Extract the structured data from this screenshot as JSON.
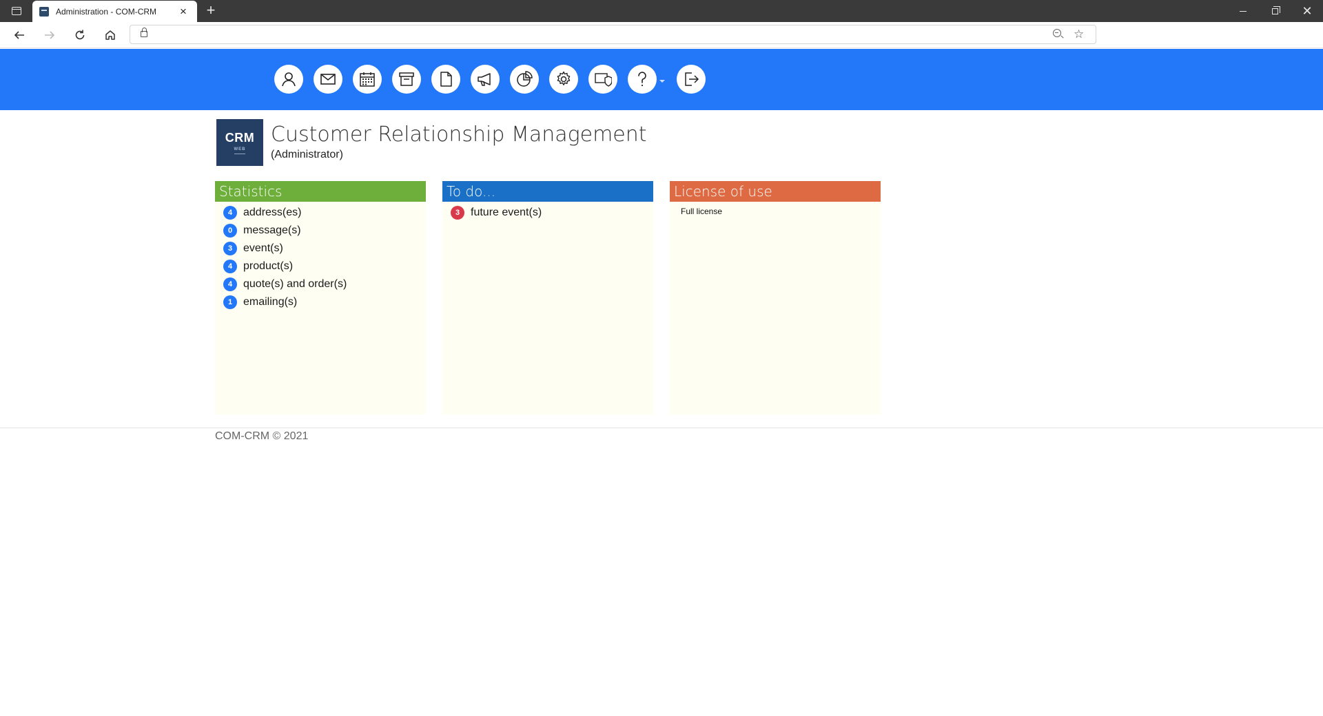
{
  "browser": {
    "tab_title": "Administration - COM-CRM",
    "tab_close": "×",
    "new_tab": "+",
    "url": "",
    "nav": {
      "back_icon": "arrow-left-icon",
      "forward_icon": "arrow-right-icon",
      "reload_icon": "reload-icon",
      "home_icon": "home-icon"
    }
  },
  "toolbar": {
    "buttons": [
      {
        "name": "contacts",
        "icon": "user-icon"
      },
      {
        "name": "messages",
        "icon": "mail-icon"
      },
      {
        "name": "calendar",
        "icon": "calendar-icon"
      },
      {
        "name": "archive",
        "icon": "archive-icon"
      },
      {
        "name": "documents",
        "icon": "document-icon"
      },
      {
        "name": "campaigns",
        "icon": "megaphone-icon"
      },
      {
        "name": "reports",
        "icon": "pie-chart-icon"
      },
      {
        "name": "settings",
        "icon": "gear-icon"
      },
      {
        "name": "security",
        "icon": "shield-icon"
      },
      {
        "name": "help",
        "icon": "question-icon",
        "has_dropdown": true
      },
      {
        "name": "logout",
        "icon": "logout-icon"
      }
    ]
  },
  "brand": {
    "logo_main": "CRM",
    "logo_sub": "WEB",
    "title": "Customer Relationship Management",
    "subtitle": "(Administrator)"
  },
  "panels": {
    "statistics": {
      "title": "Statistics",
      "color": "#6daf3a",
      "items": [
        {
          "count": "4",
          "label": "address(es)"
        },
        {
          "count": "0",
          "label": "message(s)"
        },
        {
          "count": "3",
          "label": "event(s)"
        },
        {
          "count": "4",
          "label": "product(s)"
        },
        {
          "count": "4",
          "label": "quote(s) and order(s)"
        },
        {
          "count": "1",
          "label": "emailing(s)"
        }
      ]
    },
    "todo": {
      "title": "To do...",
      "color": "#1a70c6",
      "items": [
        {
          "count": "3",
          "label": "future event(s)"
        }
      ]
    },
    "license": {
      "title": "License of use",
      "color": "#dd6a42",
      "text": "Full license"
    }
  },
  "footer": {
    "text": "COM-CRM © 2021"
  },
  "colors": {
    "header_bg": "#2278f8",
    "badge_blue": "#2278f8",
    "badge_red": "#d8394b",
    "panel_bg": "#fefef2"
  }
}
